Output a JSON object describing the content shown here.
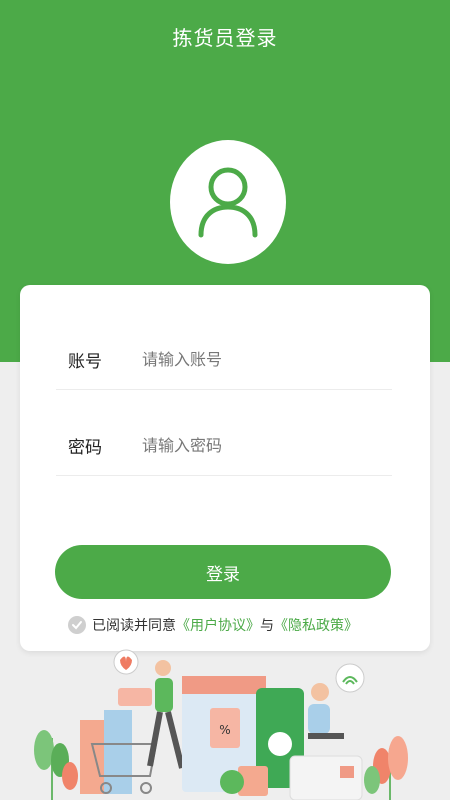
{
  "header": {
    "title": "拣货员登录"
  },
  "form": {
    "account": {
      "label": "账号",
      "placeholder": "请输入账号"
    },
    "password": {
      "label": "密码",
      "placeholder": "请输入密码"
    },
    "login_label": "登录"
  },
  "agreement": {
    "prefix": "已阅读并同意",
    "user_agreement": "《用户协议》",
    "connector": "与",
    "privacy_policy": "《隐私政策》"
  },
  "colors": {
    "primary": "#4caa48",
    "background": "#eeeeee"
  },
  "icons": {
    "avatar": "user-icon",
    "check": "check-icon"
  }
}
